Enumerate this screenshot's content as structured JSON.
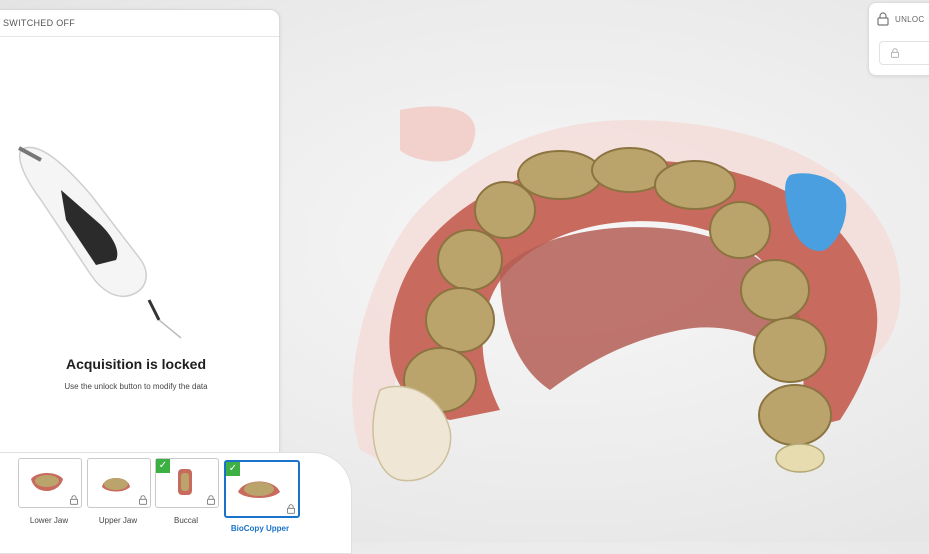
{
  "window": {
    "status": "SWITCHED OFF"
  },
  "acquisition": {
    "title": "Acquisition is locked",
    "subtitle": "Use the unlock button to modify the data"
  },
  "unlock_panel": {
    "label": "UNLOC"
  },
  "thumbnails": [
    {
      "label": "Lower Jaw",
      "checked": false,
      "active": false,
      "locked": true
    },
    {
      "label": "Upper Jaw",
      "checked": false,
      "active": false,
      "locked": true
    },
    {
      "label": "Buccal",
      "checked": true,
      "active": false,
      "locked": true
    },
    {
      "label": "BioCopy Upper",
      "checked": true,
      "active": true,
      "locked": true
    }
  ],
  "icons": {
    "lock": "lock-icon",
    "check": "checkmark-icon",
    "scanner": "intraoral-scanner-icon"
  },
  "colors": {
    "accent": "#1a73c8",
    "check": "#3cb043",
    "gum": "#c96a5e",
    "tooth": "#bba36c",
    "scan_blue": "#4a9fe0"
  }
}
